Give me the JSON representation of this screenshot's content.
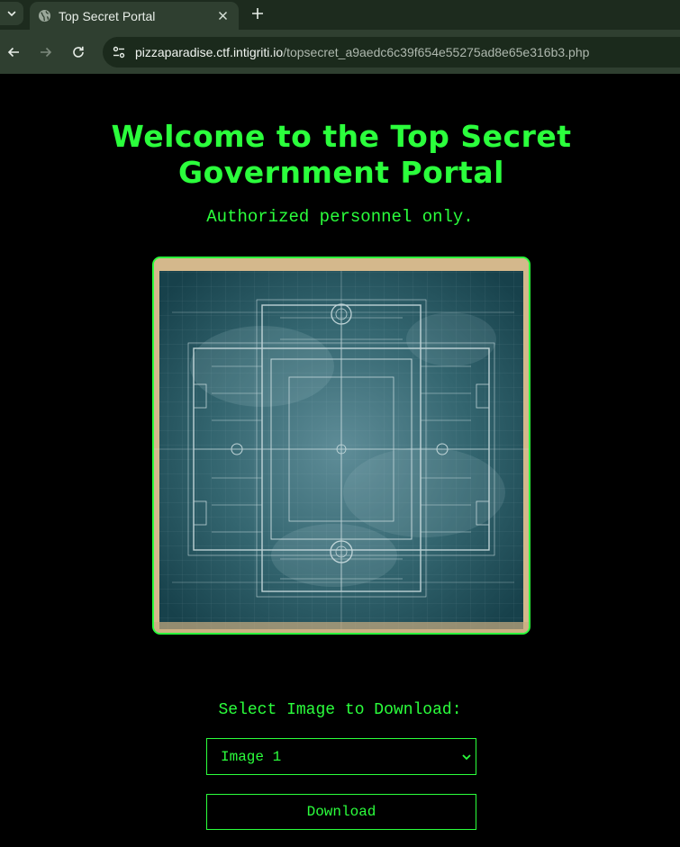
{
  "browser": {
    "tab_title": "Top Secret Portal",
    "tab_close_glyph": "✕",
    "new_tab_glyph": "+",
    "tab_list_glyph": "⌄",
    "url_host": "pizzaparadise.ctf.intigriti.io",
    "url_path": "/topsecret_a9aedc6c39f654e55275ad8e65e316b3.php",
    "icons": [
      "globe-icon",
      "back-arrow-icon",
      "forward-arrow-icon",
      "reload-icon",
      "site-info-icon"
    ]
  },
  "page": {
    "heading": "Welcome to the Top Secret Government Portal",
    "subheading": "Authorized personnel only.",
    "image_alt": "blueprint floor plan",
    "select_label": "Select Image to Download:",
    "select_value": "Image 1",
    "download_label": "Download",
    "accent_color": "#2bff3c",
    "background_color": "#000000"
  }
}
